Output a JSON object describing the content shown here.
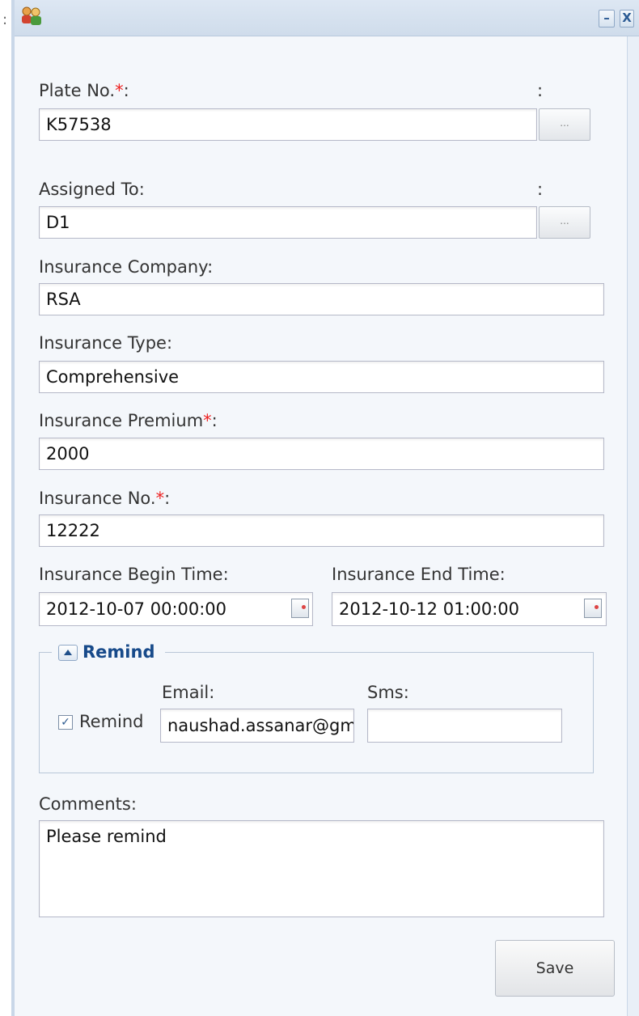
{
  "window": {
    "icon": "users-icon",
    "minimize_label": "–",
    "close_label": "X",
    "left_edge_mark": ":"
  },
  "form": {
    "plate_no": {
      "label": "Plate No.",
      "required_mark": "*",
      "suffix": ":",
      "value": "K57538",
      "trigger_label": "...",
      "side_colon": ":"
    },
    "assigned_to": {
      "label": "Assigned To:",
      "value": "D1",
      "trigger_label": "...",
      "side_colon": ":"
    },
    "insurance_company": {
      "label": "Insurance Company:",
      "value": "RSA"
    },
    "insurance_type": {
      "label": "Insurance Type:",
      "value": "Comprehensive"
    },
    "insurance_premium": {
      "label": "Insurance Premium",
      "required_mark": "*",
      "suffix": ":",
      "value": "2000"
    },
    "insurance_no": {
      "label": "Insurance No.",
      "required_mark": "*",
      "suffix": ":",
      "value": "12222"
    },
    "begin_time": {
      "label": "Insurance Begin Time:",
      "value": "2012-10-07 00:00:00"
    },
    "end_time": {
      "label": "Insurance End Time:",
      "value": "2012-10-12 01:00:00"
    },
    "remind": {
      "legend": "Remind",
      "checkbox_label": "Remind",
      "checked": true,
      "email_label": "Email:",
      "email_value": "naushad.assanar@gm",
      "sms_label": "Sms:",
      "sms_value": ""
    },
    "comments": {
      "label": "Comments:",
      "value": "Please remind"
    },
    "save_label": "Save"
  },
  "colors": {
    "required": "#e22222",
    "legend_text": "#174a8a",
    "panel_bg": "#f4f7fb",
    "titlebar_bg": "#d5e1ee"
  }
}
